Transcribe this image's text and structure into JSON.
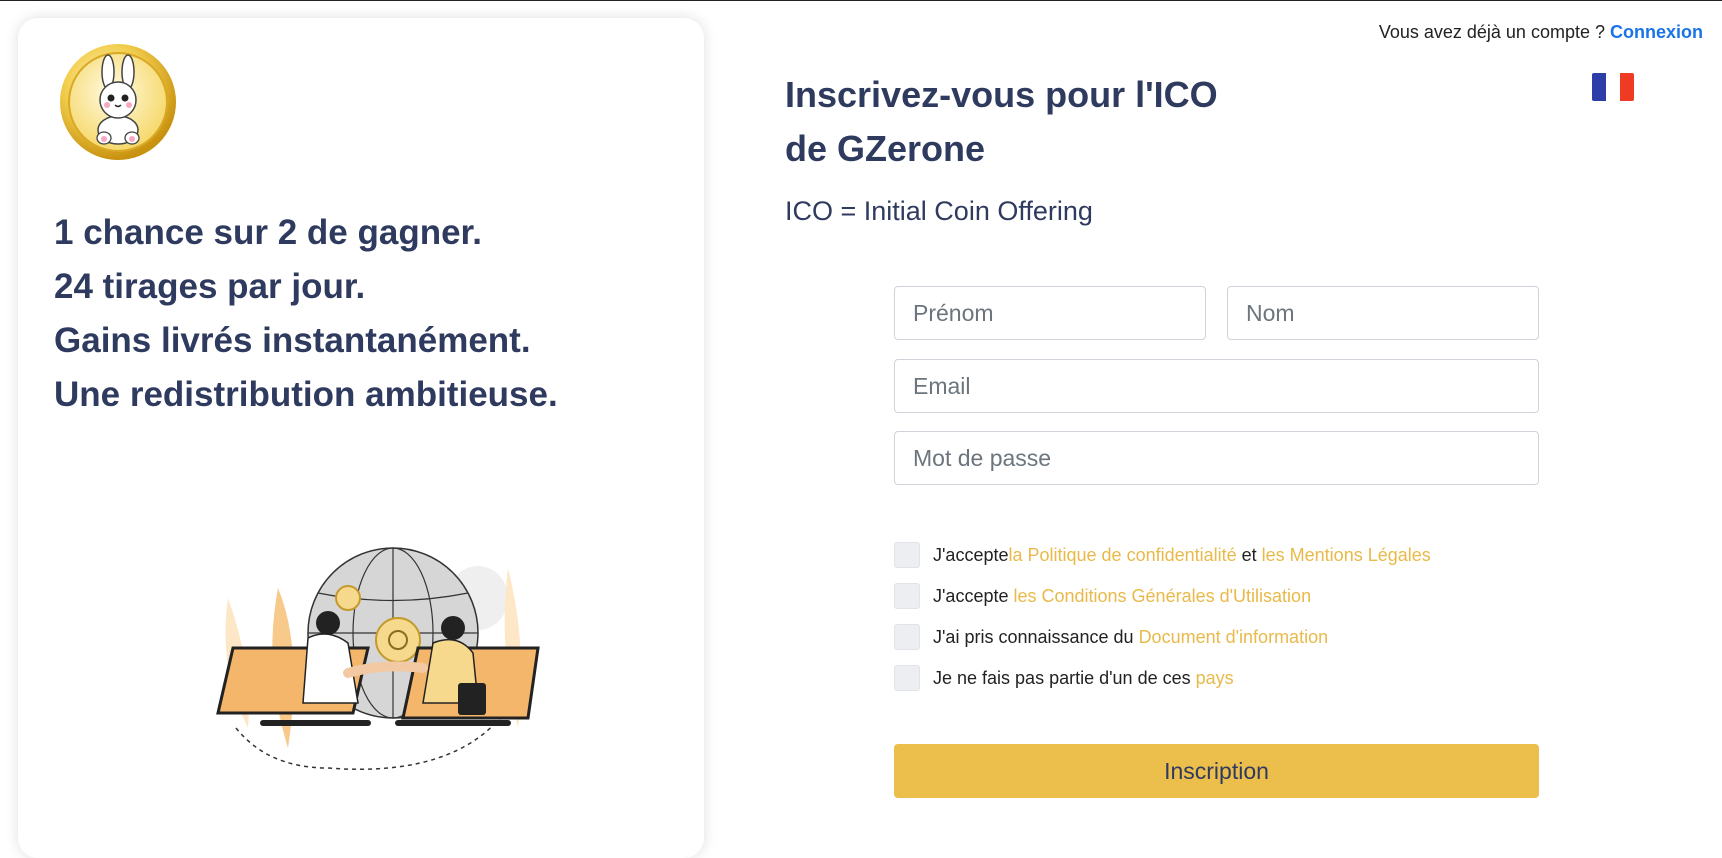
{
  "header": {
    "prompt_text": "Vous avez déjà un compte ?",
    "login_link": "Connexion",
    "flag_colors": [
      "#2d3ea8",
      "#ffffff",
      "#ef3b24"
    ]
  },
  "left_panel": {
    "logo_icon": "bunny-coin-logo",
    "taglines": [
      "1 chance sur 2 de gagner.",
      "24 tirages par jour.",
      "Gains livrés instantanément.",
      "Une redistribution ambitieuse."
    ],
    "illustration_icon": "globe-handshake-illustration"
  },
  "form": {
    "title": "Inscrivez-vous pour l'ICO de GZerone",
    "subtitle": "ICO = Initial Coin Offering",
    "first_name_placeholder": "Prénom",
    "last_name_placeholder": "Nom",
    "email_placeholder": "Email",
    "password_placeholder": "Mot de passe",
    "checkboxes": [
      {
        "prefix": "J'accepte ",
        "link1": "la Politique de confidentialité",
        "middle": " et ",
        "link2": "les Mentions Légales"
      },
      {
        "prefix": "J'accepte ",
        "link1": "les Conditions Générales d'Utilisation"
      },
      {
        "prefix": "J'ai pris connaissance du ",
        "link1": "Document d'information"
      },
      {
        "prefix": "Je ne fais pas partie d'un de ces ",
        "link1": "pays"
      }
    ],
    "submit_label": "Inscription"
  },
  "colors": {
    "heading": "#2f3a5f",
    "accent_link": "#e9b949",
    "login_link": "#1a73e8",
    "button": "#ecbe4b"
  }
}
